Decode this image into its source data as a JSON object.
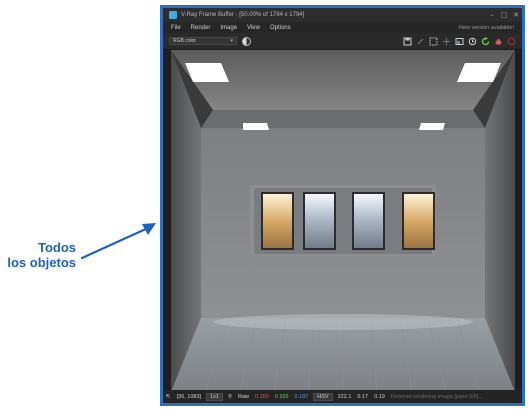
{
  "callout": {
    "line1": "Todos",
    "line2": "los objetos",
    "color": "#1f5fc0"
  },
  "window": {
    "title": "V-Ray Frame Buffer - [50.00% of 1794 x 1794]",
    "menu": [
      "File",
      "Render",
      "Image",
      "View",
      "Options"
    ],
    "new_version": "New version available!",
    "channel": "RGB color",
    "toolbar_icons": [
      "save-icon",
      "clear-icon",
      "region-icon",
      "compare-icon",
      "history-icon",
      "track-mouse-icon",
      "refresh-icon",
      "teapot-icon",
      "stop-icon"
    ],
    "status": {
      "coords": "[36, 1083]",
      "zoom": "1x1",
      "mode": "Raw",
      "r": "0.150",
      "g": "0.165",
      "b": "0.187",
      "space": "HSV",
      "h": "222.1",
      "s": "0.17",
      "v": "0.19",
      "message": "Finished rendering image [pass 5/5]..."
    },
    "accent": "#2f6ec7"
  }
}
